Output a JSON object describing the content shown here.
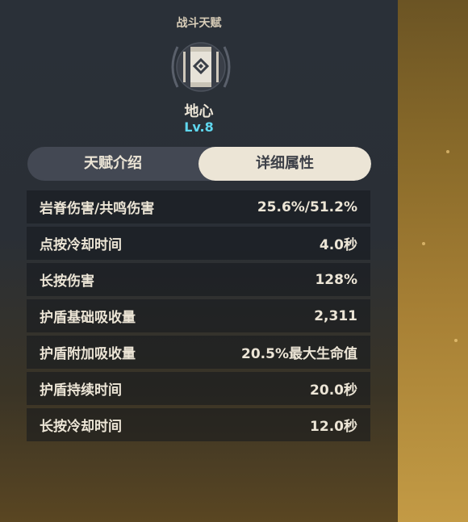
{
  "talent": {
    "category": "战斗天赋",
    "name": "地心",
    "level": "Lv.8",
    "icon": "geo-pillar-icon"
  },
  "tabs": [
    {
      "label": "天赋介绍",
      "active": false
    },
    {
      "label": "详细属性",
      "active": true
    }
  ],
  "stats": [
    {
      "label": "岩脊伤害/共鸣伤害",
      "value": "25.6%/51.2%"
    },
    {
      "label": "点按冷却时间",
      "value": "4.0秒"
    },
    {
      "label": "长按伤害",
      "value": "128%"
    },
    {
      "label": "护盾基础吸收量",
      "value": "2,311"
    },
    {
      "label": "护盾附加吸收量",
      "value": "20.5%最大生命值"
    },
    {
      "label": "护盾持续时间",
      "value": "20.0秒"
    },
    {
      "label": "长按冷却时间",
      "value": "12.0秒"
    }
  ],
  "colors": {
    "level": "#5fd7ee",
    "active_tab_bg": "#ece5d6",
    "text": "#ece5d6"
  }
}
